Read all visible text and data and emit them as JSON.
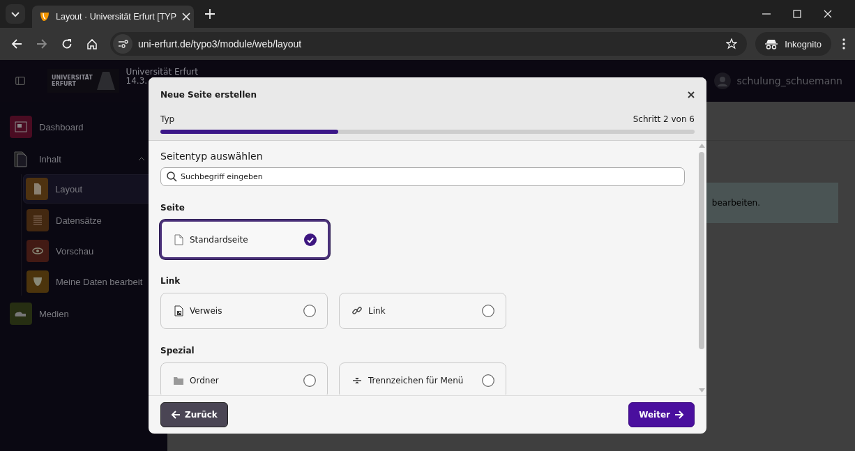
{
  "browser": {
    "tabs": [
      {
        "title": "Layout · Universität Erfurt [TYP",
        "selected": true
      }
    ],
    "url": "uni-erfurt.de/typo3/module/web/layout",
    "profile": "Inkognito"
  },
  "header": {
    "logo_lines": [
      "UNIVERSITÄT",
      "ERFURT"
    ],
    "site_name": "Universität Erfurt",
    "version": "14.3.",
    "user": "schulung_schuemann"
  },
  "sidebar": {
    "items": [
      {
        "label": "Dashboard",
        "kind": "module",
        "color": "#4a0c22",
        "selected": false
      },
      {
        "label": "Inhalt",
        "kind": "group",
        "expanded": true,
        "children": [
          {
            "label": "Layout",
            "kind": "module",
            "color": "#4e3210",
            "selected": true
          },
          {
            "label": "Datensätze",
            "kind": "module",
            "color": "#432810",
            "selected": false
          },
          {
            "label": "Vorschau",
            "kind": "module",
            "color": "#421a14",
            "selected": false
          },
          {
            "label": "Meine Daten bearbeit",
            "kind": "module",
            "color": "#4c340c",
            "selected": false
          }
        ]
      },
      {
        "label": "Medien",
        "kind": "module",
        "color": "#262e12",
        "selected": false
      }
    ]
  },
  "content": {
    "notice": "bearbeiten."
  },
  "modal": {
    "title": "Neue Seite erstellen",
    "step_label": "Typ",
    "step_count": "Schritt 2 von 6",
    "progress": {
      "level": 0.333
    },
    "heading": "Seitentyp auswählen",
    "search": {
      "placeholder": "Suchbegriff eingeben"
    },
    "groups": [
      {
        "title": "Seite",
        "options": [
          {
            "label": "Standardseite",
            "kind": "page",
            "selected": true
          }
        ]
      },
      {
        "title": "Link",
        "options": [
          {
            "label": "Verweis",
            "kind": "shortcut",
            "selected": false
          },
          {
            "label": "Link",
            "kind": "link",
            "selected": false
          }
        ]
      },
      {
        "title": "Spezial",
        "options": [
          {
            "label": "Ordner",
            "kind": "folder",
            "selected": false
          },
          {
            "label": "Trennzeichen für Menü",
            "kind": "separator",
            "selected": false
          }
        ]
      }
    ],
    "buttons": [
      {
        "label": "Zurück",
        "kind": "back"
      },
      {
        "label": "Weiter",
        "kind": "next"
      }
    ]
  }
}
